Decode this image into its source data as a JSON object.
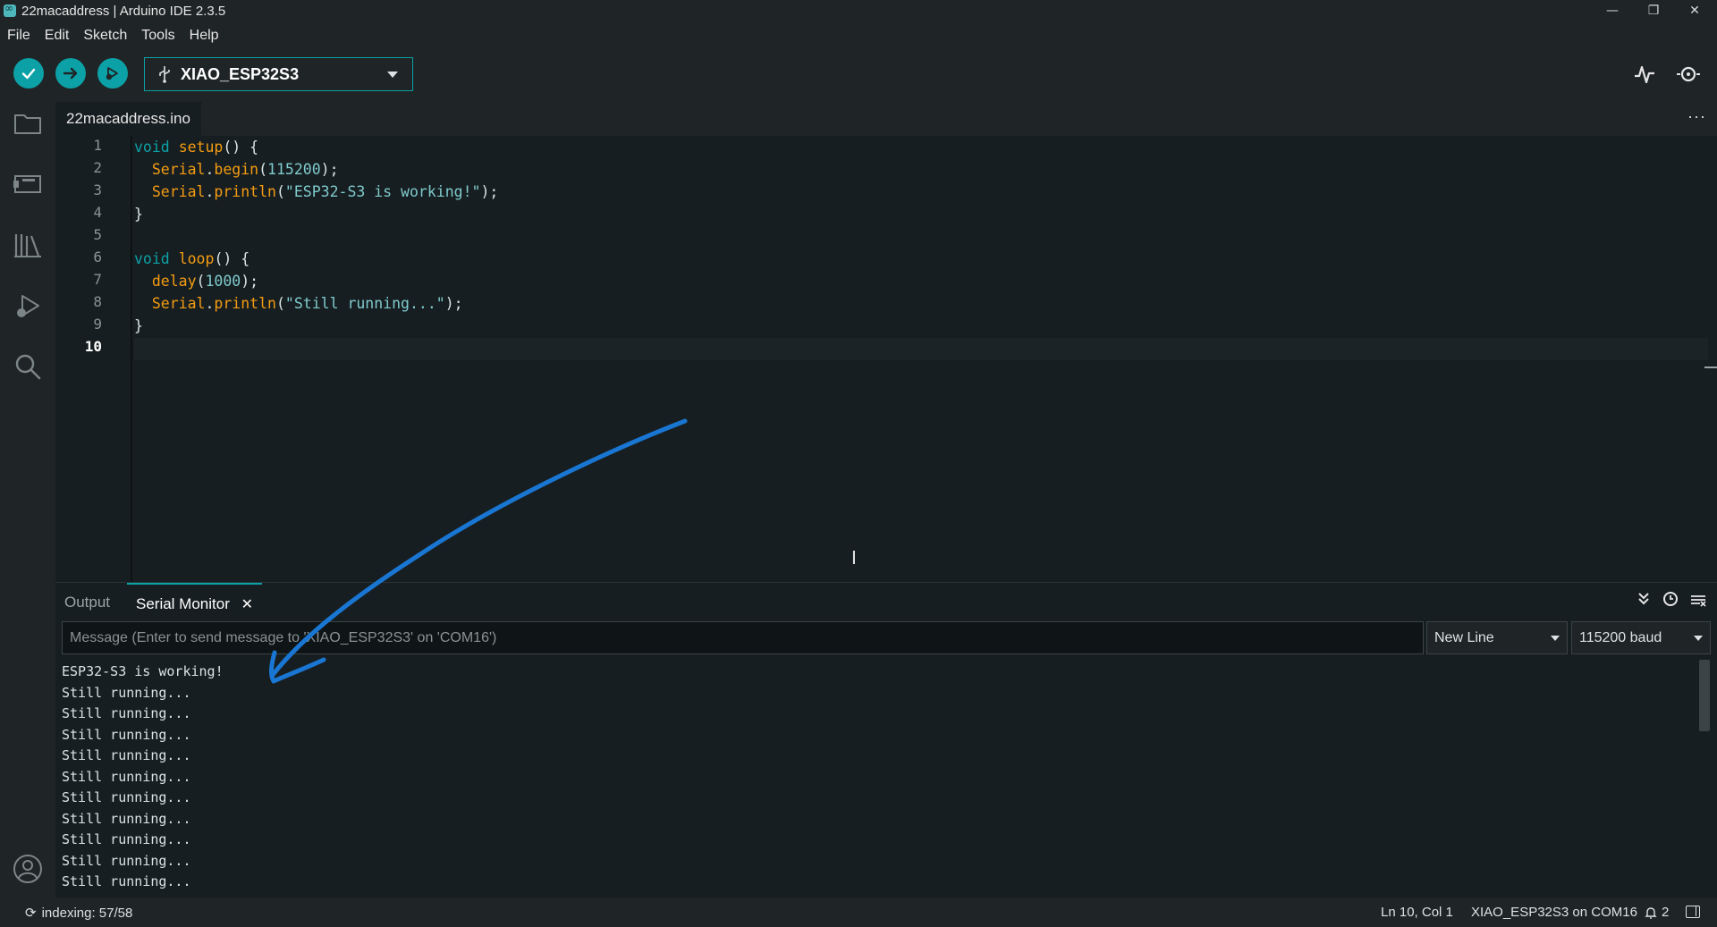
{
  "window": {
    "title": "22macaddress | Arduino IDE 2.3.5",
    "minimize": "—",
    "maximize": "❐",
    "close": "✕"
  },
  "menu": {
    "items": [
      "File",
      "Edit",
      "Sketch",
      "Tools",
      "Help"
    ]
  },
  "toolbar": {
    "verify_icon": "check-icon",
    "upload_icon": "arrow-right-icon",
    "debug_icon": "debug-icon",
    "board": "XIAO_ESP32S3",
    "plotter_icon": "serial-plotter-icon",
    "monitor_icon": "serial-monitor-icon"
  },
  "activity_bar": {
    "icons": [
      "sketchbook-icon",
      "boards-manager-icon",
      "library-manager-icon",
      "debug-icon",
      "search-icon",
      "account-icon"
    ]
  },
  "editor": {
    "file_tab": "22macaddress.ino",
    "more": "···",
    "line_numbers": [
      "1",
      "2",
      "3",
      "4",
      "5",
      "6",
      "7",
      "8",
      "9",
      "10"
    ],
    "current_line": "10",
    "code": [
      "void setup() {",
      "  Serial.begin(115200);",
      "  Serial.println(\"ESP32-S3 is working!\");",
      "}",
      "",
      "void loop() {",
      "  delay(1000);",
      "  Serial.println(\"Still running...\");",
      "}",
      ""
    ]
  },
  "panel": {
    "tab_output": "Output",
    "tab_serial": "Serial Monitor",
    "tab_close": "✕",
    "message_placeholder": "Message (Enter to send message to 'XIAO_ESP32S3' on 'COM16')",
    "line_ending": "New Line",
    "baud": "115200 baud",
    "serial_lines": [
      "ESP32-S3 is working!",
      "Still running...",
      "Still running...",
      "Still running...",
      "Still running...",
      "Still running...",
      "Still running...",
      "Still running...",
      "Still running...",
      "Still running...",
      "Still running..."
    ]
  },
  "status": {
    "indexing": "indexing: 57/58",
    "cursor": "Ln 10, Col 1",
    "board_port": "XIAO_ESP32S3 on COM16",
    "notifications": "2"
  },
  "colors": {
    "accent": "#0ca1a6",
    "annotation_arrow": "#1976d2"
  }
}
